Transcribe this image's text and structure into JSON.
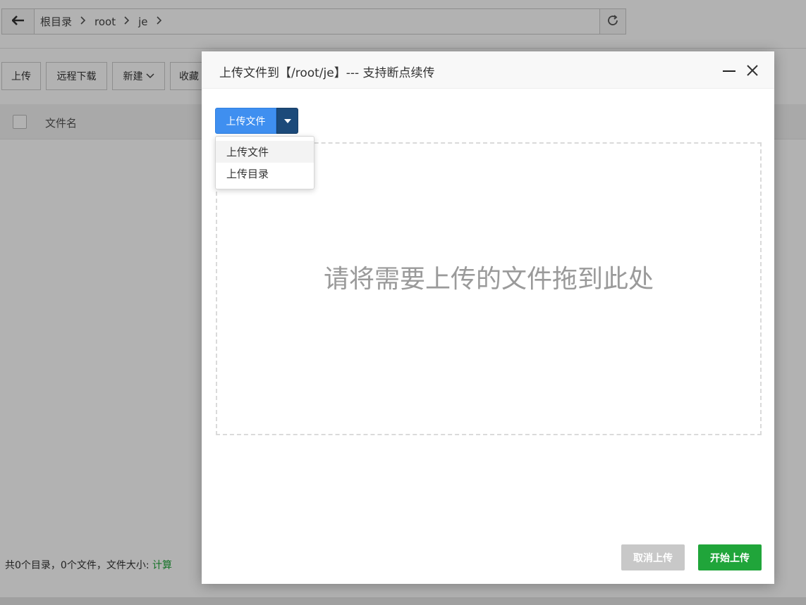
{
  "pathbar": {
    "back_icon": "arrow-left-icon",
    "crumbs": [
      "根目录",
      "root",
      "je"
    ],
    "refresh_icon": "refresh-icon"
  },
  "toolbar": {
    "upload": "上传",
    "remote_download": "远程下载",
    "new": "新建",
    "favorites": "收藏"
  },
  "table": {
    "col_filename": "文件名"
  },
  "summary": {
    "text": "共0个目录，0个文件，文件大小: ",
    "calc": "计算"
  },
  "modal": {
    "title": "上传文件到【/root/je】--- 支持断点续传",
    "upload_button": "上传文件",
    "dropdown": [
      "上传文件",
      "上传目录"
    ],
    "drop_hint": "请将需要上传的文件拖到此处",
    "cancel": "取消上传",
    "start": "开始上传"
  },
  "colors": {
    "primary_blue": "#3f8ff0",
    "dark_blue": "#1c4a7a",
    "green": "#20a53a",
    "disabled_gray": "#c8c8c8"
  }
}
